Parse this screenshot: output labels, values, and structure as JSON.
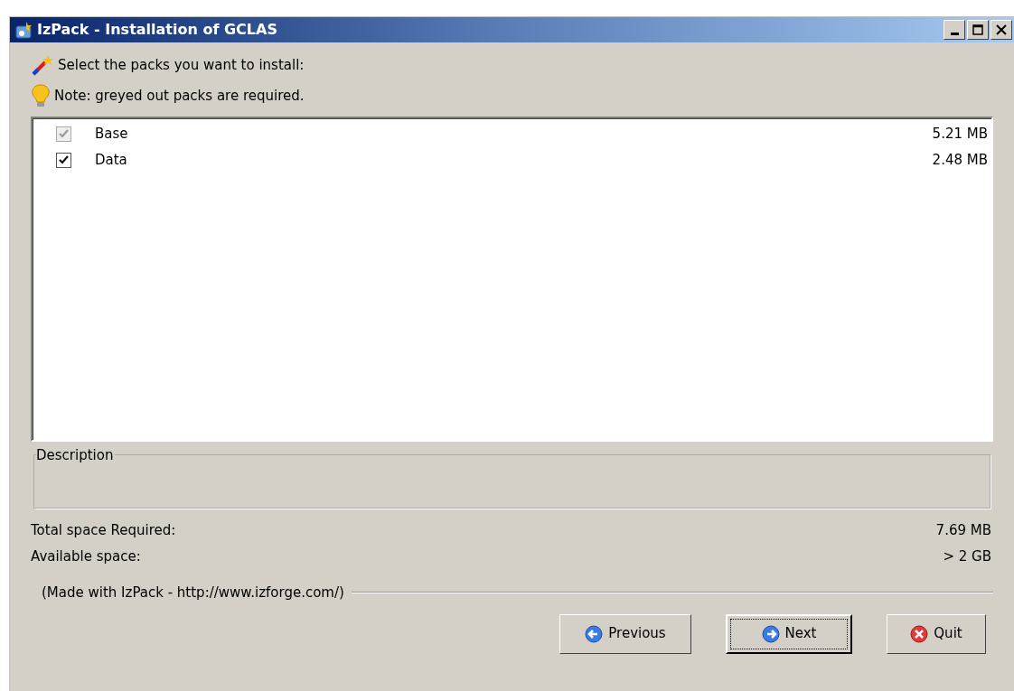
{
  "window": {
    "title": "IzPack - Installation of GCLAS"
  },
  "intro": "Select the packs you want to install:",
  "note": "Note: greyed out packs are required.",
  "packs": [
    {
      "name": "Base",
      "size": "5.21 MB",
      "checked": true,
      "disabled": true
    },
    {
      "name": "Data",
      "size": "2.48 MB",
      "checked": true,
      "disabled": false
    }
  ],
  "description": {
    "label": "Description"
  },
  "space": [
    {
      "label": "Total space Required:",
      "value": "7.69 MB"
    },
    {
      "label": "Available space:",
      "value": "> 2 GB"
    }
  ],
  "credit": "(Made with IzPack - http://www.izforge.com/)",
  "buttons": [
    {
      "label": "Previous",
      "kind": "previous",
      "focused": false
    },
    {
      "label": "Next",
      "kind": "next",
      "focused": true
    },
    {
      "label": "Quit",
      "kind": "quit",
      "focused": false
    }
  ]
}
